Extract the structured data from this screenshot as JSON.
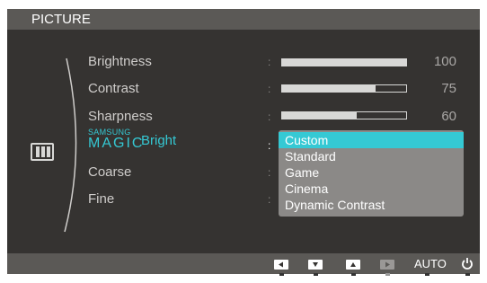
{
  "title": "PICTURE",
  "category_icon": "picture-icon",
  "menu": {
    "items": [
      {
        "label": "Brightness",
        "value": "100",
        "level": 1.0
      },
      {
        "label": "Contrast",
        "value": "75",
        "level": 0.75
      },
      {
        "label": "Sharpness",
        "value": "60",
        "level": 0.6
      },
      {
        "label": "Coarse"
      },
      {
        "label": "Fine"
      }
    ],
    "magic": {
      "brand": "SAMSUNG",
      "word": "MAGIC",
      "label": "Bright"
    },
    "separator": ":"
  },
  "dropdown": {
    "options": [
      "Custom",
      "Standard",
      "Game",
      "Cinema",
      "Dynamic Contrast"
    ],
    "selected": "Custom"
  },
  "bottom": {
    "buttons": [
      "left-icon",
      "down-icon",
      "up-icon",
      "enter-icon"
    ],
    "auto_label": "AUTO",
    "power_icon": "power-icon"
  },
  "colors": {
    "background": "#353331",
    "bar": "#5b5956",
    "accent": "#35c9d4",
    "dropdown": "#8b8987"
  }
}
